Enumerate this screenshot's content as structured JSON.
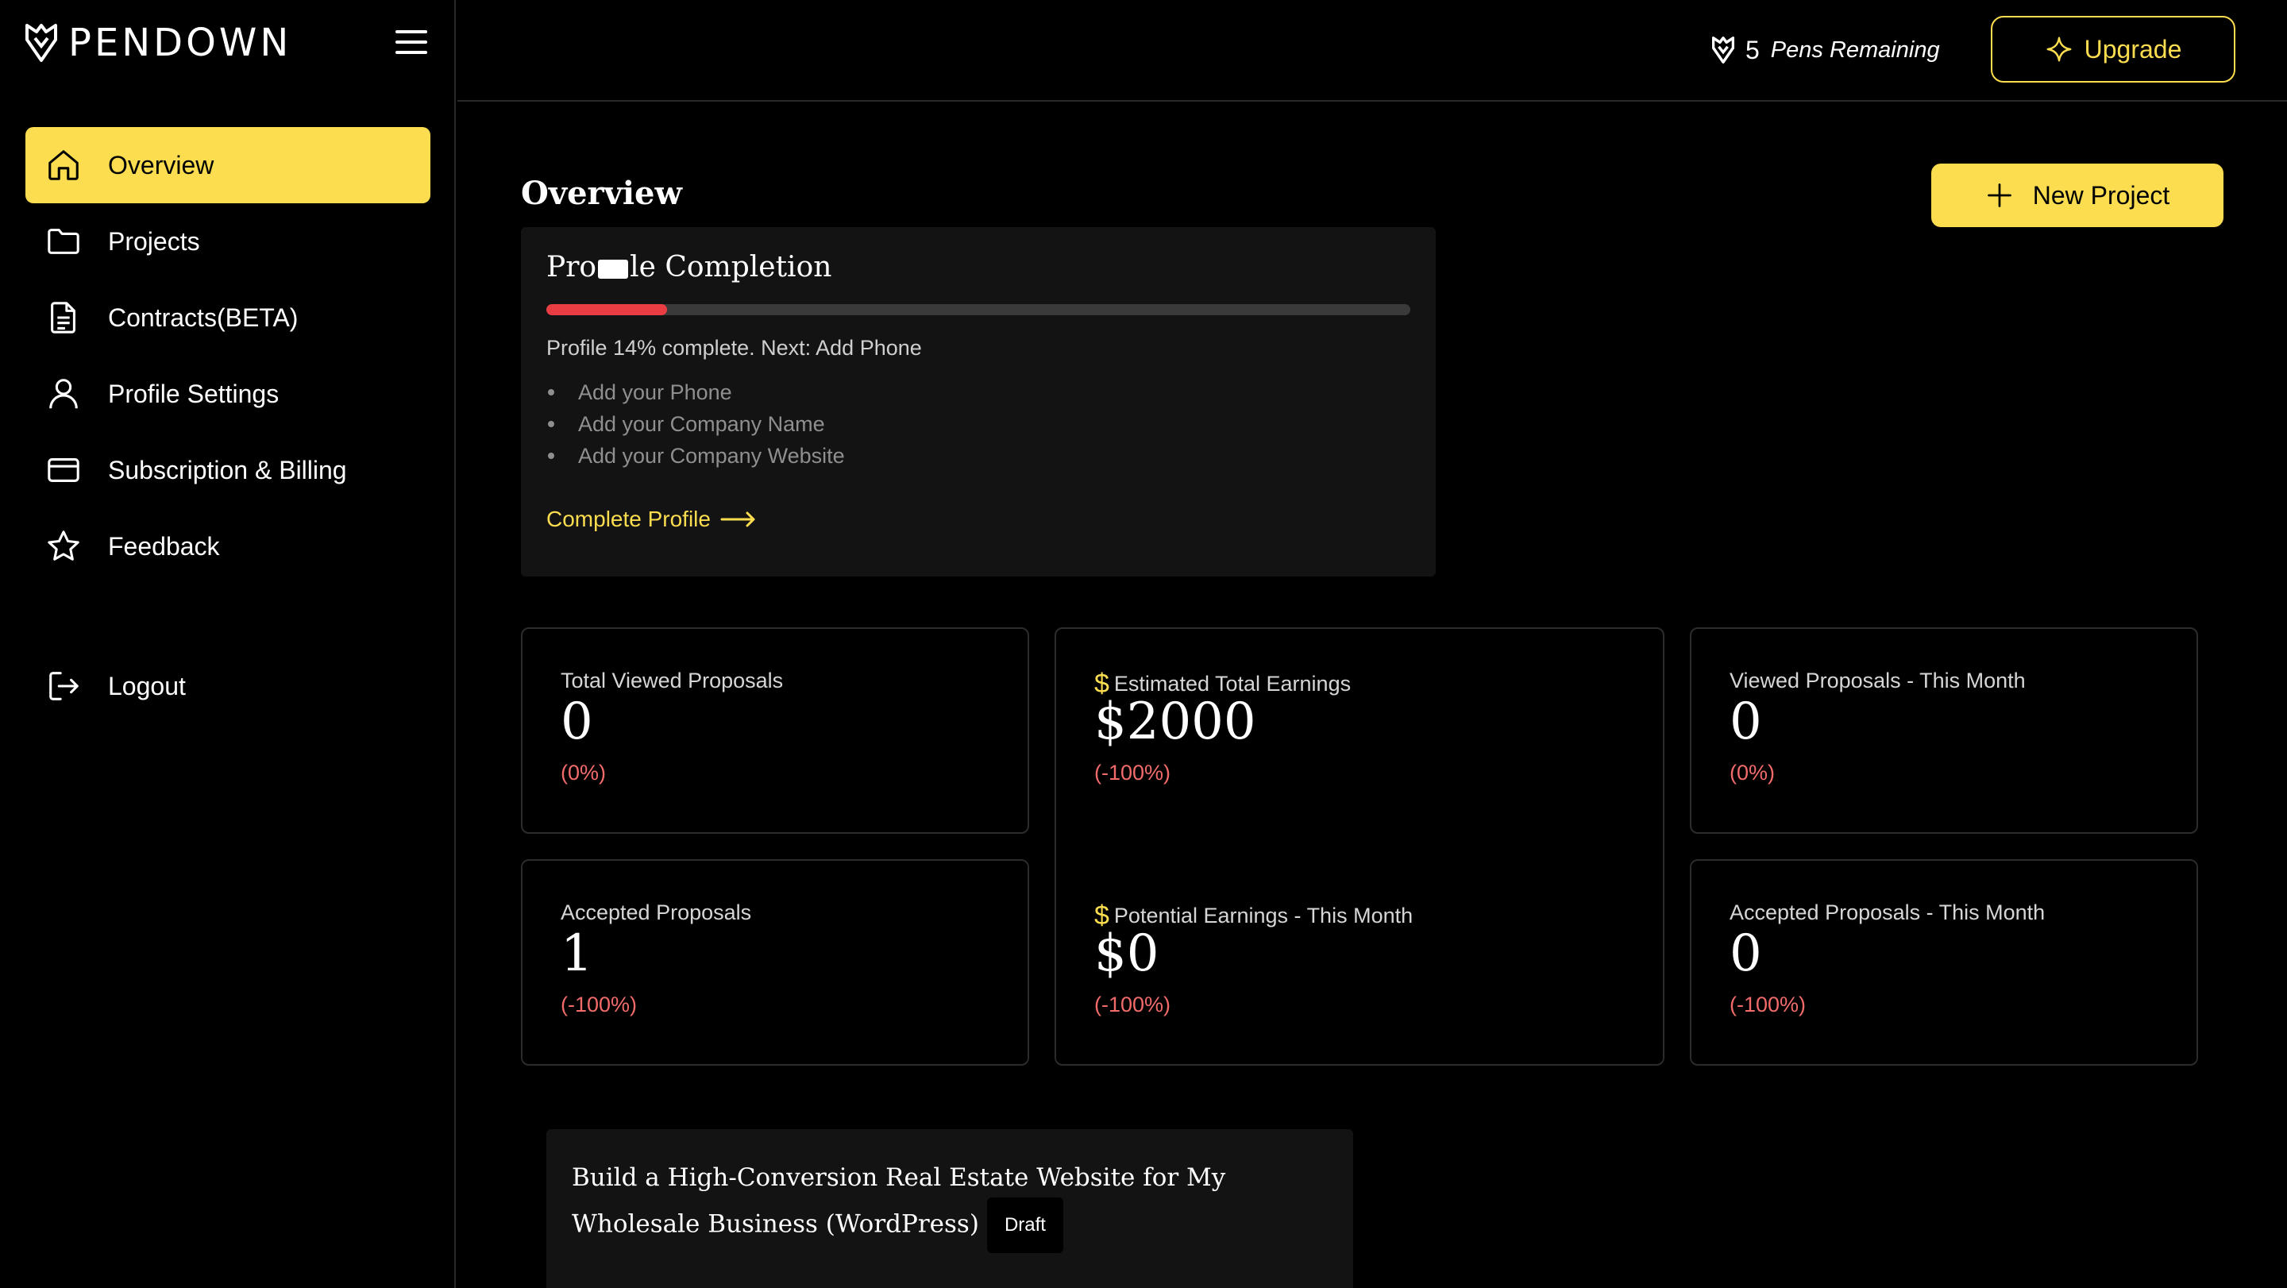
{
  "brand": {
    "name": "PENDOWN"
  },
  "sidebar": {
    "items": [
      {
        "label": "Overview",
        "icon": "home-icon",
        "active": true
      },
      {
        "label": "Projects",
        "icon": "folder-icon"
      },
      {
        "label": "Contracts(BETA)",
        "icon": "document-icon"
      },
      {
        "label": "Profile Settings",
        "icon": "user-icon"
      },
      {
        "label": "Subscription & Billing",
        "icon": "credit-card-icon"
      },
      {
        "label": "Feedback",
        "icon": "star-icon"
      }
    ],
    "logout_label": "Logout"
  },
  "topbar": {
    "pens_count": "5",
    "pens_label": "Pens Remaining",
    "upgrade_label": "Upgrade"
  },
  "main": {
    "title": "Overview",
    "new_project_label": "New Project"
  },
  "profile_completion": {
    "title": "Pro\u0000le Completion",
    "percent": 14,
    "status": "Profile 14% complete. Next: Add Phone",
    "todos": [
      "Add your Phone",
      "Add your Company Name",
      "Add your Company Website"
    ],
    "cta": "Complete Profile"
  },
  "stats": {
    "total_viewed": {
      "label": "Total Viewed Proposals",
      "value": "0",
      "change": "(0%)"
    },
    "estimated_earnings": {
      "label": "Estimated Total Earnings",
      "value": "$2000",
      "change": "(-100%)"
    },
    "viewed_month": {
      "label": "Viewed Proposals - This Month",
      "value": "0",
      "change": "(0%)"
    },
    "accepted": {
      "label": "Accepted Proposals",
      "value": "1",
      "change": "(-100%)"
    },
    "potential_month": {
      "label": "Potential Earnings - This Month",
      "value": "$0",
      "change": "(-100%)"
    },
    "accepted_month": {
      "label": "Accepted Proposals - This Month",
      "value": "0",
      "change": "(-100%)"
    }
  },
  "project": {
    "title": "Build a High-Conversion Real Estate Website for My Wholesale Business (WordPress)",
    "badge": "Draft"
  },
  "colors": {
    "accent": "#fcdd4f",
    "danger": "#ea3d43",
    "change_red": "#f16b6b",
    "card_bg": "#131313"
  }
}
